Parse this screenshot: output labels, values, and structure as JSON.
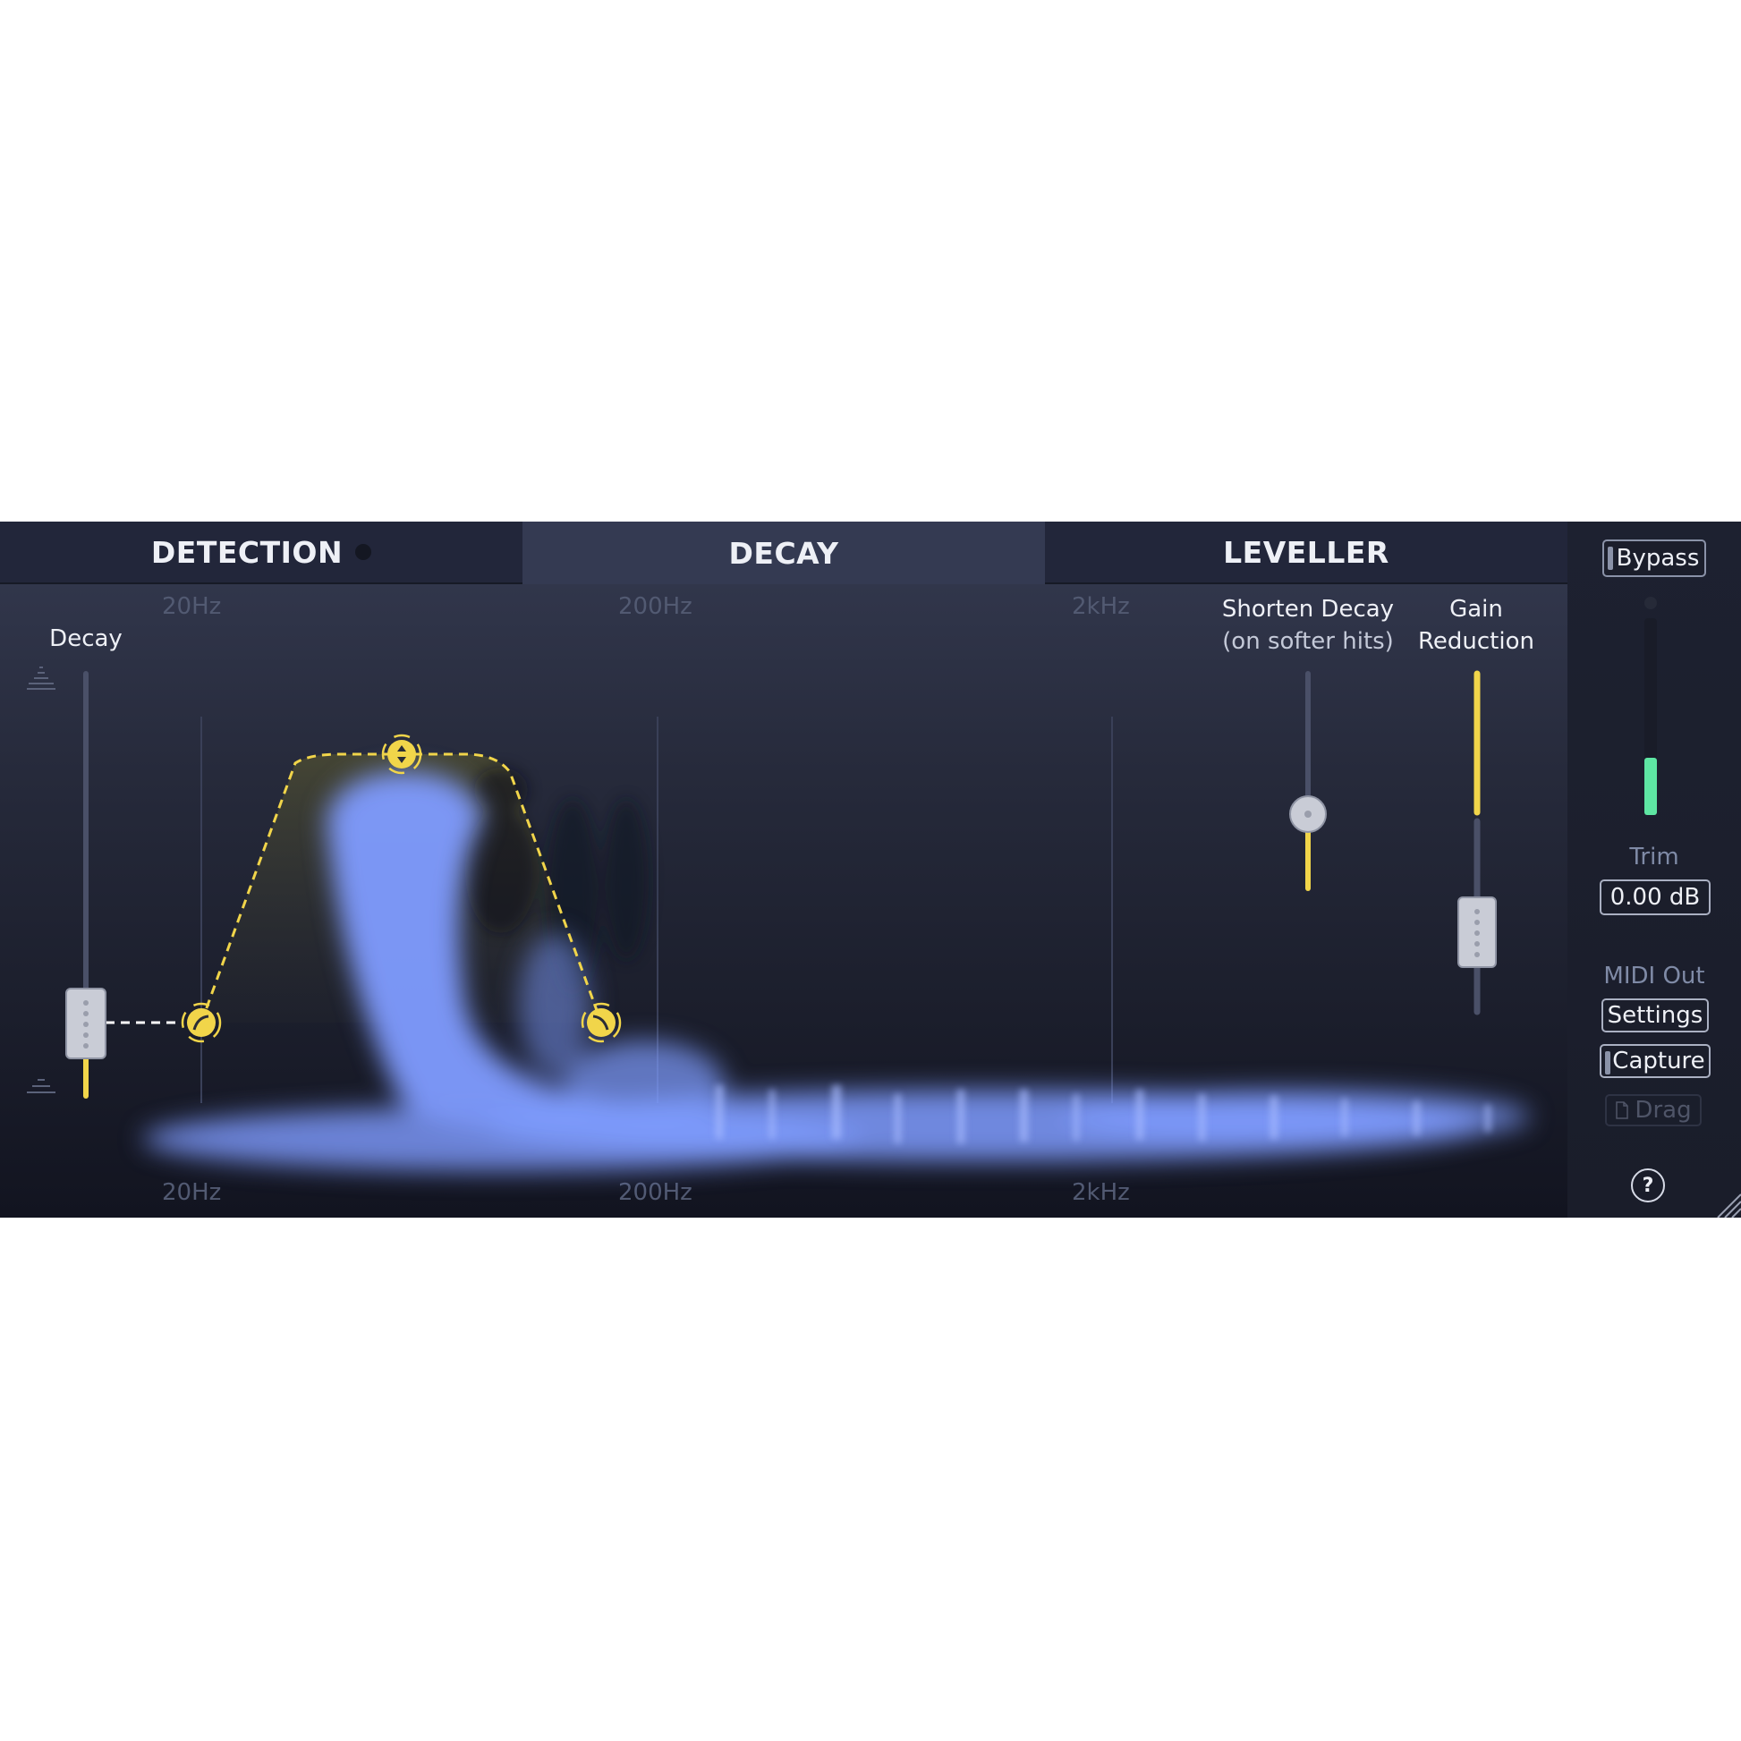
{
  "tabs": {
    "detection": "DETECTION",
    "decay": "DECAY",
    "leveller": "LEVELLER"
  },
  "freq_axis": {
    "top": [
      "20Hz",
      "200Hz",
      "2kHz"
    ],
    "bottom": [
      "20Hz",
      "200Hz",
      "2kHz"
    ]
  },
  "decay_slider": {
    "label": "Decay"
  },
  "shorten_decay": {
    "label_line1": "Shorten Decay",
    "label_line2": "(on softer hits)"
  },
  "gain_reduction": {
    "label_line1": "Gain",
    "label_line2": "Reduction"
  },
  "sidebar": {
    "bypass_label": "Bypass",
    "trim_label": "Trim",
    "trim_value": "0.00 dB",
    "midi_out_label": "MIDI Out",
    "settings_label": "Settings",
    "capture_label": "Capture",
    "drag_label": "Drag",
    "help_label": "?"
  },
  "colors": {
    "accent_yellow": "#f1d54a",
    "spectrum_blue": "#7f9cff",
    "meter_green": "#5ee6a3",
    "panel_bg": "#1f2331"
  },
  "icons": {
    "high_pass": "high-pass-filter-icon",
    "low_pass": "low-pass-filter-icon",
    "peak": "up-down-arrows-icon",
    "help": "question-mark-icon",
    "resize": "resize-grip-icon",
    "document": "document-icon"
  }
}
